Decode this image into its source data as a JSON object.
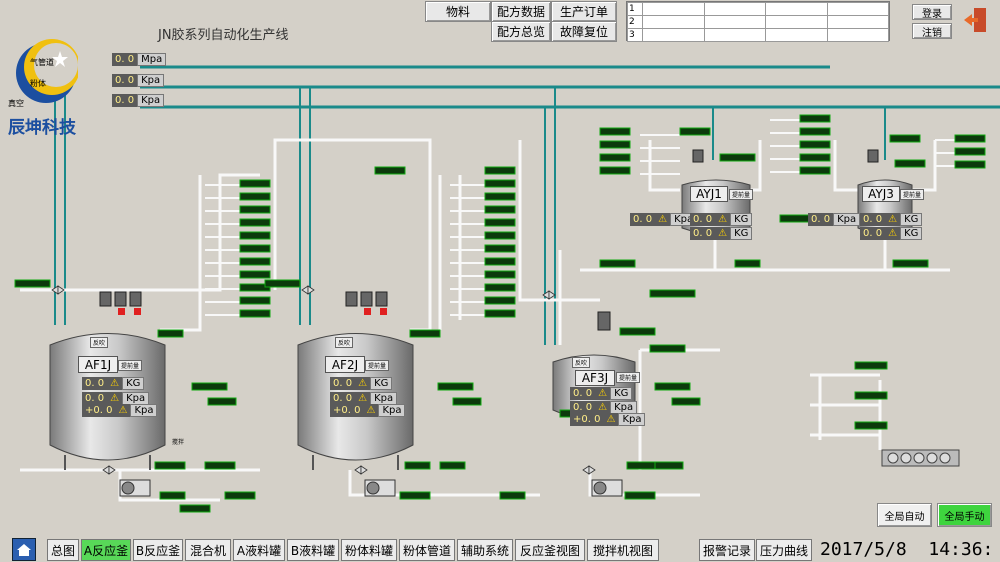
{
  "header": {
    "logo_text": "辰坤科技",
    "title": "JN胶系列自动化生产线",
    "menu": {
      "material": "物料",
      "recipe_data": "配方数据",
      "production_order": "生产订单",
      "recipe_overview": "配方总览",
      "fault_reset": "故障复位"
    },
    "table_rows": [
      "1",
      "2",
      "3"
    ],
    "login": "登录",
    "logout": "注销"
  },
  "pressures": [
    {
      "label": "气管道",
      "value": "0. 0",
      "unit": "Mpa"
    },
    {
      "label": "粉体",
      "value": "0. 0",
      "unit": "Kpa"
    },
    {
      "label": "真空",
      "value": "0. 0",
      "unit": "Kpa"
    }
  ],
  "tanks": {
    "af1j": {
      "name": "AF1J",
      "preweight": "提前量",
      "kg": "0. 0",
      "kpa": "0. 0",
      "temp": "+0. 0",
      "kg_unit": "KG",
      "kpa_unit": "Kpa"
    },
    "af2j": {
      "name": "AF2J",
      "preweight": "提前量",
      "kg": "0. 0",
      "kpa": "0. 0",
      "temp": "+0. 0",
      "kg_unit": "KG",
      "kpa_unit": "Kpa"
    },
    "af3j": {
      "name": "AF3J",
      "preweight": "提前量",
      "kg": "0. 0",
      "kpa": "0. 0",
      "temp": "+0. 0",
      "kg_unit": "KG",
      "kpa_unit": "Kpa"
    },
    "ayj1": {
      "name": "AYJ1",
      "preweight": "提前量",
      "kpa": "0. 0",
      "kg1": "0. 0",
      "kg2": "0. 0",
      "kpa_unit": "Kpa",
      "kg_unit": "KG"
    },
    "ayj3": {
      "name": "AYJ3",
      "preweight": "提前量",
      "kpa": "0. 0",
      "kg1": "0. 0",
      "kg2": "0. 0",
      "kpa_unit": "Kpa",
      "kg_unit": "KG"
    }
  },
  "small_labels": {
    "blow": "反吹",
    "stir": "搅拌"
  },
  "mode": {
    "auto": "全局自动",
    "manual": "全局手动"
  },
  "nav": [
    "总图",
    "A反应釜",
    "B反应釜",
    "混合机",
    "A液料罐",
    "B液料罐",
    "粉体料罐",
    "粉体管道",
    "辅助系统",
    "反应釜视图",
    "搅拌机视图",
    "报警记录",
    "压力曲线"
  ],
  "datetime": "2017/5/8  14:36:",
  "colors": {
    "pipe_teal": "#1a8a8a",
    "pipe_gray": "#f0f0f0",
    "active_nav": "#58d858",
    "indicator_green": "#0c3a0c"
  }
}
